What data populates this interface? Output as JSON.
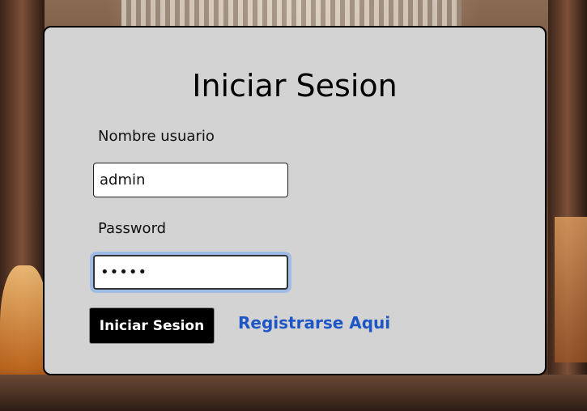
{
  "login": {
    "title": "Iniciar Sesion",
    "username_label": "Nombre usuario",
    "username_value": "admin",
    "password_label": "Password",
    "password_value": "admin",
    "submit_label": "Iniciar Sesion",
    "register_link": "Registrarse Aqui"
  },
  "colors": {
    "card_bg": "#d3d3d3",
    "button_bg": "#000000",
    "link": "#1f56c5",
    "focus_ring": "#9fbce6"
  }
}
